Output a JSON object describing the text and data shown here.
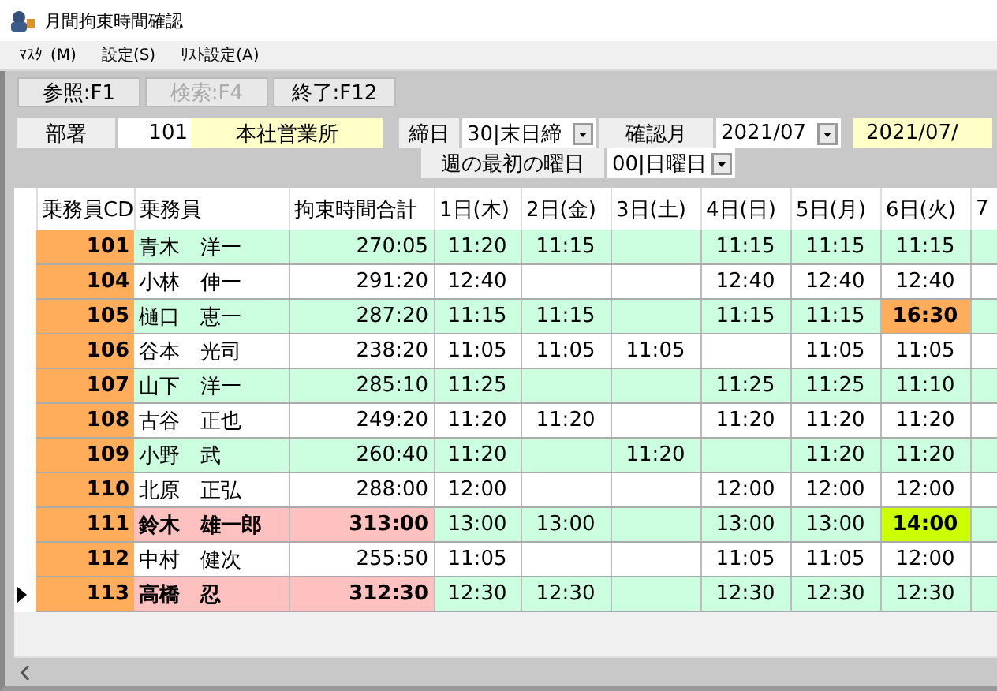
{
  "window": {
    "title": "月間拘束時間確認"
  },
  "menu": [
    "ﾏｽﾀｰ(M)",
    "設定(S)",
    "ﾘｽﾄ設定(A)"
  ],
  "toolbar": [
    {
      "label": "参照:F1",
      "disabled": false
    },
    {
      "label": "検索:F4",
      "disabled": true
    },
    {
      "label": "終了:F12",
      "disabled": false
    }
  ],
  "filters": {
    "department": {
      "label": "部署",
      "code": "101",
      "name": "本社営業所"
    },
    "closing_day": {
      "label": "締日",
      "value": "30|末日締"
    },
    "month": {
      "label": "確認月",
      "value": "2021/07",
      "display": "2021/07/"
    },
    "week_start": {
      "label": "週の最初の曜日",
      "value": "00|日曜日"
    }
  },
  "table": {
    "columns": [
      "乗務員CD",
      "乗務員",
      "拘束時間合計",
      "1日(木)",
      "2日(金)",
      "3日(土)",
      "4日(日)",
      "5日(月)",
      "6日(火)",
      "7"
    ],
    "rows": [
      {
        "code": "101",
        "name": "青木　洋一",
        "total": "270:05",
        "alert": false,
        "selected": false,
        "days": [
          {
            "value": "11:20",
            "exceeded": false,
            "flagged": false
          },
          {
            "value": "11:15",
            "exceeded": false,
            "flagged": false
          },
          {
            "exceeded": false,
            "flagged": false
          },
          {
            "value": "11:15",
            "exceeded": false,
            "flagged": false
          },
          {
            "value": "11:15",
            "exceeded": false,
            "flagged": false
          },
          {
            "value": "11:15",
            "exceeded": false,
            "flagged": false
          }
        ]
      },
      {
        "code": "104",
        "name": "小林　伸一",
        "total": "291:20",
        "alert": false,
        "selected": false,
        "days": [
          {
            "value": "12:40",
            "exceeded": false,
            "flagged": false
          },
          {
            "exceeded": false,
            "flagged": false
          },
          {
            "exceeded": false,
            "flagged": false
          },
          {
            "value": "12:40",
            "exceeded": false,
            "flagged": false
          },
          {
            "value": "12:40",
            "exceeded": false,
            "flagged": false
          },
          {
            "value": "12:40",
            "exceeded": false,
            "flagged": false
          }
        ]
      },
      {
        "code": "105",
        "name": "樋口　恵一",
        "total": "287:20",
        "alert": false,
        "selected": false,
        "days": [
          {
            "value": "11:15",
            "exceeded": false,
            "flagged": false
          },
          {
            "value": "11:15",
            "exceeded": false,
            "flagged": false
          },
          {
            "exceeded": false,
            "flagged": false
          },
          {
            "value": "11:15",
            "exceeded": false,
            "flagged": false
          },
          {
            "value": "11:15",
            "exceeded": false,
            "flagged": false
          },
          {
            "value": "16:30",
            "exceeded": true,
            "flagged": false
          }
        ]
      },
      {
        "code": "106",
        "name": "谷本　光司",
        "total": "238:20",
        "alert": false,
        "selected": false,
        "days": [
          {
            "value": "11:05",
            "exceeded": false,
            "flagged": false
          },
          {
            "value": "11:05",
            "exceeded": false,
            "flagged": false
          },
          {
            "value": "11:05",
            "exceeded": false,
            "flagged": false
          },
          {
            "exceeded": false,
            "flagged": false
          },
          {
            "value": "11:05",
            "exceeded": false,
            "flagged": false
          },
          {
            "value": "11:05",
            "exceeded": false,
            "flagged": false
          }
        ]
      },
      {
        "code": "107",
        "name": "山下　洋一",
        "total": "285:10",
        "alert": false,
        "selected": false,
        "days": [
          {
            "value": "11:25",
            "exceeded": false,
            "flagged": false
          },
          {
            "exceeded": false,
            "flagged": false
          },
          {
            "exceeded": false,
            "flagged": false
          },
          {
            "value": "11:25",
            "exceeded": false,
            "flagged": false
          },
          {
            "value": "11:25",
            "exceeded": false,
            "flagged": false
          },
          {
            "value": "11:10",
            "exceeded": false,
            "flagged": false
          }
        ]
      },
      {
        "code": "108",
        "name": "古谷　正也",
        "total": "249:20",
        "alert": false,
        "selected": false,
        "days": [
          {
            "value": "11:20",
            "exceeded": false,
            "flagged": false
          },
          {
            "value": "11:20",
            "exceeded": false,
            "flagged": false
          },
          {
            "exceeded": false,
            "flagged": false
          },
          {
            "value": "11:20",
            "exceeded": false,
            "flagged": false
          },
          {
            "value": "11:20",
            "exceeded": false,
            "flagged": false
          },
          {
            "value": "11:20",
            "exceeded": false,
            "flagged": false
          }
        ]
      },
      {
        "code": "109",
        "name": "小野　武",
        "total": "260:40",
        "alert": false,
        "selected": false,
        "days": [
          {
            "value": "11:20",
            "exceeded": false,
            "flagged": false
          },
          {
            "exceeded": false,
            "flagged": false
          },
          {
            "value": "11:20",
            "exceeded": false,
            "flagged": false
          },
          {
            "exceeded": false,
            "flagged": false
          },
          {
            "value": "11:20",
            "exceeded": false,
            "flagged": false
          },
          {
            "value": "11:20",
            "exceeded": false,
            "flagged": false
          }
        ]
      },
      {
        "code": "110",
        "name": "北原　正弘",
        "total": "288:00",
        "alert": false,
        "selected": false,
        "days": [
          {
            "value": "12:00",
            "exceeded": false,
            "flagged": false
          },
          {
            "exceeded": false,
            "flagged": false
          },
          {
            "exceeded": false,
            "flagged": false
          },
          {
            "value": "12:00",
            "exceeded": false,
            "flagged": false
          },
          {
            "value": "12:00",
            "exceeded": false,
            "flagged": false
          },
          {
            "value": "12:00",
            "exceeded": false,
            "flagged": false
          }
        ]
      },
      {
        "code": "111",
        "name": "鈴木　雄一郎",
        "total": "313:00",
        "alert": true,
        "selected": false,
        "days": [
          {
            "value": "13:00",
            "exceeded": false,
            "flagged": false
          },
          {
            "value": "13:00",
            "exceeded": false,
            "flagged": false
          },
          {
            "exceeded": false,
            "flagged": false
          },
          {
            "value": "13:00",
            "exceeded": false,
            "flagged": false
          },
          {
            "value": "13:00",
            "exceeded": false,
            "flagged": false
          },
          {
            "value": "14:00",
            "exceeded": false,
            "flagged": true
          }
        ]
      },
      {
        "code": "112",
        "name": "中村　健次",
        "total": "255:50",
        "alert": false,
        "selected": false,
        "days": [
          {
            "value": "11:05",
            "exceeded": false,
            "flagged": false
          },
          {
            "exceeded": false,
            "flagged": false
          },
          {
            "exceeded": false,
            "flagged": false
          },
          {
            "value": "11:05",
            "exceeded": false,
            "flagged": false
          },
          {
            "value": "11:05",
            "exceeded": false,
            "flagged": false
          },
          {
            "value": "12:00",
            "exceeded": false,
            "flagged": false
          }
        ]
      },
      {
        "code": "113",
        "name": "高橋　忍",
        "total": "312:30",
        "alert": true,
        "selected": true,
        "days": [
          {
            "value": "12:30",
            "exceeded": false,
            "flagged": false
          },
          {
            "value": "12:30",
            "exceeded": false,
            "flagged": false
          },
          {
            "exceeded": false,
            "flagged": false
          },
          {
            "value": "12:30",
            "exceeded": false,
            "flagged": false
          },
          {
            "value": "12:30",
            "exceeded": false,
            "flagged": false
          },
          {
            "value": "12:30",
            "exceeded": false,
            "flagged": false
          }
        ]
      }
    ]
  }
}
